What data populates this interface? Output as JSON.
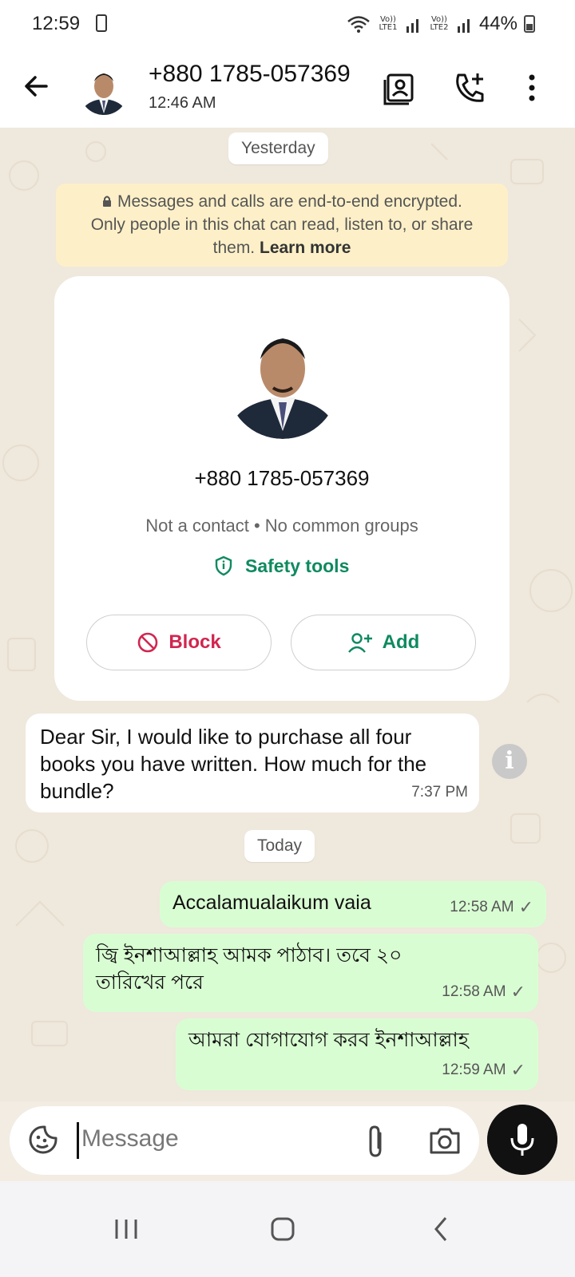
{
  "status": {
    "time": "12:59",
    "lte1": "Vo)) LTE1",
    "lte2": "Vo)) LTE2",
    "battery": "44%"
  },
  "header": {
    "title": "+880 1785-057369",
    "subtitle": "12:46 AM",
    "icons": [
      "back-arrow-icon",
      "contact-card-icon",
      "add-call-icon",
      "more-vert-icon"
    ]
  },
  "chat": {
    "date_yesterday": "Yesterday",
    "encryption_line1": "Messages and calls are end-to-end encrypted.",
    "encryption_line2": "Only people in this chat can read, listen to, or share",
    "encryption_line3_start": "them.",
    "encryption_link": "Learn more",
    "contact_card": {
      "number": "+880 1785-057369",
      "meta": "Not a contact • No common groups",
      "safety": "Safety tools",
      "block_label": "Block",
      "add_label": "Add"
    },
    "incoming": {
      "text": "Dear Sir, I would like to purchase all four books you have written. How much for the bundle?",
      "time": "7:37 PM"
    },
    "date_today": "Today",
    "outgoing": [
      {
        "text": "Accalamualaikum vaia",
        "time": "12:58 AM"
      },
      {
        "text": "জ্বি ইনশাআল্লাহ আমক পাঠাব। তবে ২০ তারিখের পরে",
        "time": "12:58 AM"
      },
      {
        "text": "আমরা যোগাযোগ করব ইনশাআল্লাহ",
        "time": "12:59 AM"
      }
    ]
  },
  "composer": {
    "placeholder": "Message"
  },
  "colors": {
    "accent_green": "#0f8a5f",
    "block_red": "#d1264f",
    "outgoing_bubble": "#d9fdd3",
    "encryption_bg": "#fdf0c8"
  }
}
